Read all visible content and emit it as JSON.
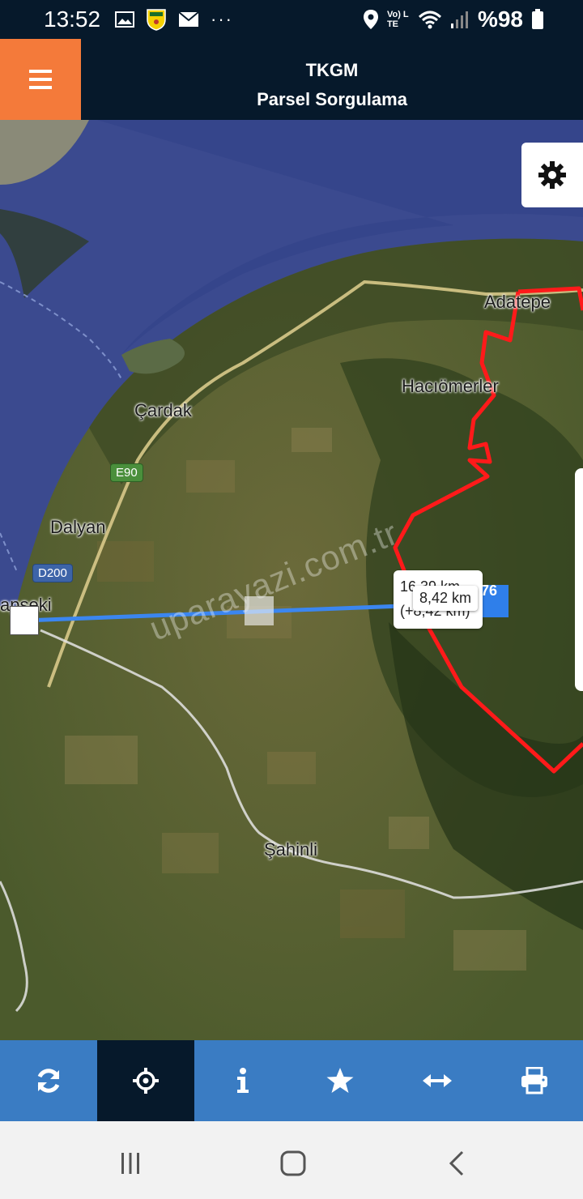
{
  "status_bar": {
    "time": "13:52",
    "network": "Vo) LTE",
    "battery": "%98",
    "more": "···",
    "icons": [
      "gallery-icon",
      "app-badge-icon",
      "mail-icon",
      "location-icon",
      "wifi-icon",
      "signal-icon",
      "battery-icon"
    ]
  },
  "header": {
    "title": "TKGM",
    "subtitle": "Parsel Sorgulama"
  },
  "map": {
    "place_labels": {
      "adatepe": "Adatepe",
      "haciomerler": "Hacıömerler",
      "cardak": "Çardak",
      "dalyan": "Dalyan",
      "lapseki": "apseki",
      "sahinli": "Şahinli"
    },
    "road_badges": {
      "e90": "E90",
      "d200": "D200"
    },
    "measurement": {
      "total_distance": "16,39 km",
      "segment_added": "(+8,42 km)",
      "segment_label": "8,42 km",
      "end_marker_text": "76"
    },
    "watermark": "uparayazi.com.tr",
    "colors": {
      "parcel_boundary": "#ff1a1a",
      "measure_line": "#3b86f0",
      "sea": "#3b4a8f"
    }
  },
  "toolbar": {
    "active_tool": "locate",
    "tools": [
      "refresh-icon",
      "crosshair-icon",
      "info-icon",
      "star-icon",
      "measure-icon",
      "print-icon"
    ],
    "colors": {
      "bar": "#3a7cc3",
      "active": "#06192b",
      "accent_menu": "#f47a3a"
    }
  },
  "nav_bar": {
    "buttons": [
      "recents",
      "home",
      "back"
    ]
  }
}
